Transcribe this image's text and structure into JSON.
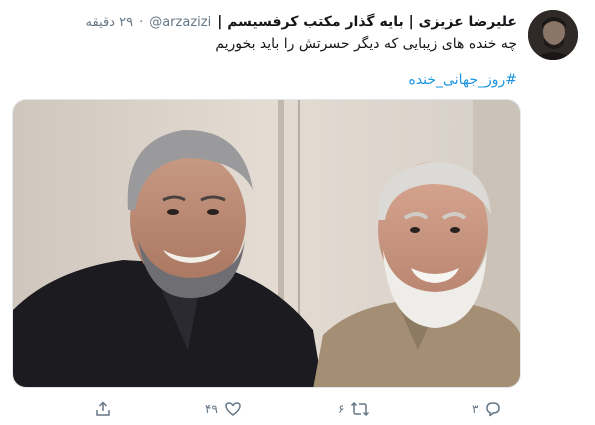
{
  "tweet": {
    "display_name": "علیرضا عزیزی | بایه گذار مکتب کرفسیسم |",
    "handle": "@arzazizi",
    "separator": "·",
    "time": "۲۹ دقیقه",
    "text": "چه خنده های زیبایی که دیگر حسرتش را باید بخوریم",
    "hashtag": "#روز_جهانی_خنده"
  },
  "actions": {
    "reply_count": "۳",
    "retweet_count": "۶",
    "like_count": "۴۹",
    "reply_icon": "reply-icon",
    "retweet_icon": "retweet-icon",
    "like_icon": "heart-icon",
    "share_icon": "share-icon"
  },
  "colors": {
    "text": "#14171a",
    "secondary": "#657786",
    "link": "#1b95e0",
    "border": "#e1e8ed"
  }
}
